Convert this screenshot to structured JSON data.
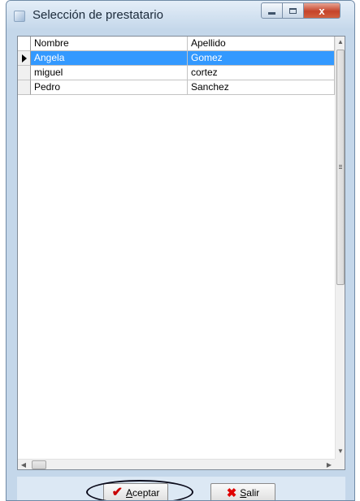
{
  "window": {
    "title": "Selección de prestatario",
    "controls": {
      "minimize": "minimize-icon",
      "maximize": "maximize-icon",
      "close": "x"
    }
  },
  "grid": {
    "columns": [
      "Nombre",
      "Apellido"
    ],
    "rows": [
      {
        "nombre": "Angela",
        "apellido": "Gomez",
        "selected": true
      },
      {
        "nombre": "miguel",
        "apellido": "cortez",
        "selected": false
      },
      {
        "nombre": "Pedro",
        "apellido": "Sanchez",
        "selected": false
      }
    ]
  },
  "buttons": {
    "accept": {
      "first": "A",
      "rest": "ceptar"
    },
    "exit": {
      "first": "S",
      "rest": "alir"
    }
  },
  "colors": {
    "selection": "#3399ff",
    "window_frame": "#c4d7ea",
    "close": "#c5442a",
    "annotation": "#0a0a1a"
  }
}
